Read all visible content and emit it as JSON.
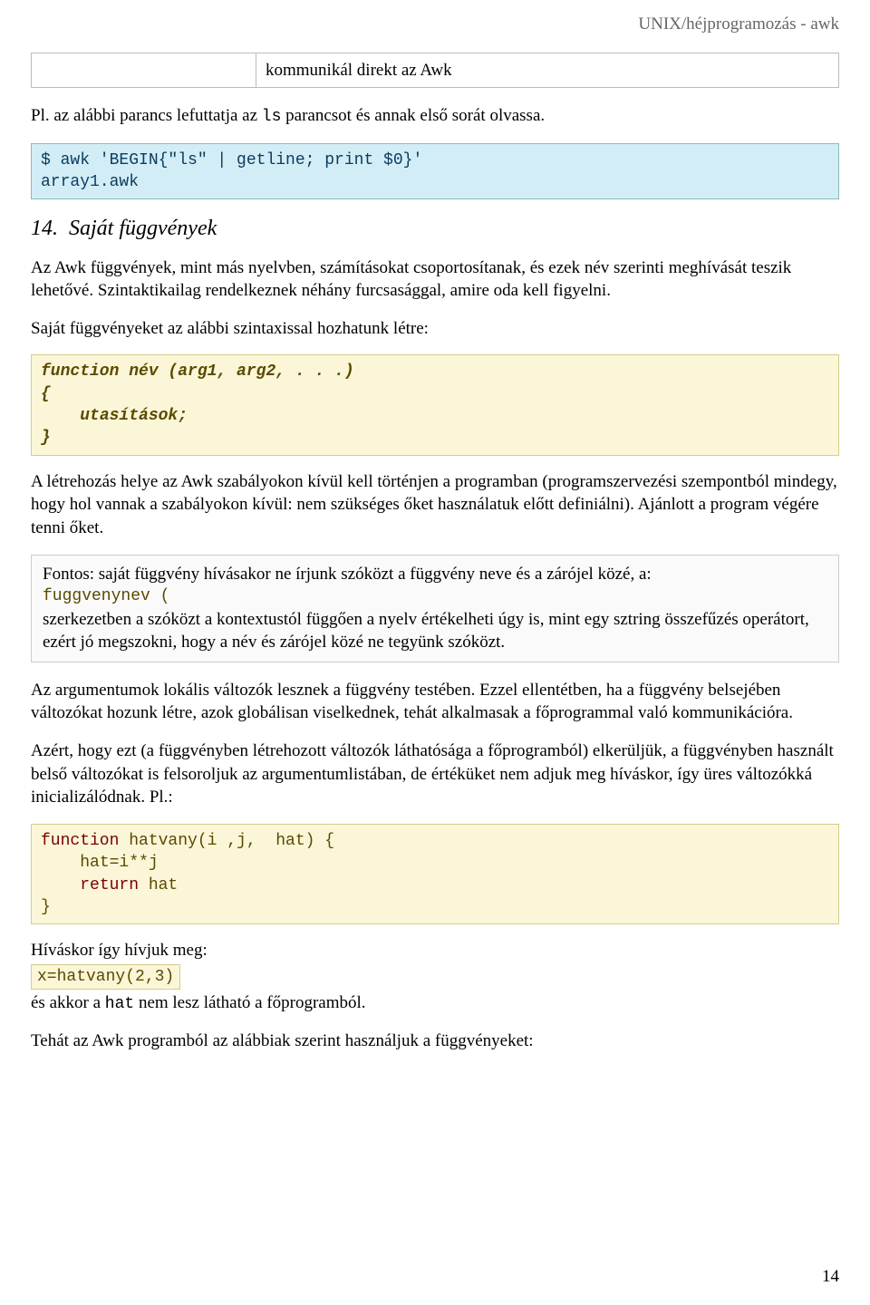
{
  "running_head": "UNIX/héjprogramozás - awk",
  "table_row_right": "kommunikál direkt az Awk",
  "para1_a": "Pl. az alábbi parancs lefuttatja az ",
  "para1_code": "ls",
  "para1_b": " parancsot és annak első sorát olvassa.",
  "code1": "$ awk 'BEGIN{\"ls\" | getline; print $0}'\narray1.awk",
  "sect_num": "14.",
  "sect_title": "Saját függvények",
  "para2": "Az Awk függvények, mint más nyelvben, számításokat csoportosítanak, és ezek név szerinti meghívását teszik lehetővé. Szintaktikailag rendelkeznek néhány furcsasággal, amire oda kell figyelni.",
  "para3": "Saját függvényeket az alábbi szintaxissal hozhatunk létre:",
  "code2": {
    "l1a": "function",
    "l1b": " név (arg1, arg2, . . .)",
    "l2": "{",
    "l3": "    utasítások;",
    "l4": "}"
  },
  "para4": "A létrehozás helye az Awk szabályokon kívül kell történjen a programban (programszervezési szempontból mindegy, hogy hol vannak a szabályokon kívül: nem szükséges őket használatuk előtt definiálni). Ajánlott a program végére tenni őket.",
  "note": {
    "l1": "Fontos: saját függvény hívásakor ne írjunk szóközt a függvény neve és a zárójel közé, a:",
    "mono": "fuggvenynev (",
    "l2": "szerkezetben a szóközt a kontextustól függően a nyelv értékelheti úgy is, mint egy sztring összefűzés operátort, ezért jó megszokni, hogy a név és zárójel közé ne tegyünk szóközt."
  },
  "para5": "Az argumentumok lokális változók lesznek a függvény testében. Ezzel ellentétben, ha a függvény belsejében változókat hozunk létre, azok globálisan viselkednek, tehát alkalmasak a főprogrammal való kommunikációra.",
  "para6": "Azért, hogy ezt (a függvényben létrehozott változók láthatósága a főprogramból) elkerüljük, a függvényben használt belső változókat is felsoroljuk az argumentumlistában, de értéküket nem adjuk meg híváskor, így üres változókká inicializálódnak. Pl.:",
  "code3": {
    "l1a": "function ",
    "l1b": "hatvany(i ,j,  hat) {",
    "l2": "    hat=i**j",
    "l3a": "    ",
    "l3b": "return",
    "l3c": " hat",
    "l4": "}"
  },
  "para7a": "Híváskor így hívjuk meg:",
  "inline_code": "x=hatvany(2,3)",
  "para7b_a": "és akkor a ",
  "para7b_code": "hat",
  "para7b_b": " nem lesz látható a főprogramból.",
  "para8": "Tehát az Awk programból az alábbiak szerint használjuk a függvényeket:",
  "page_number": "14"
}
